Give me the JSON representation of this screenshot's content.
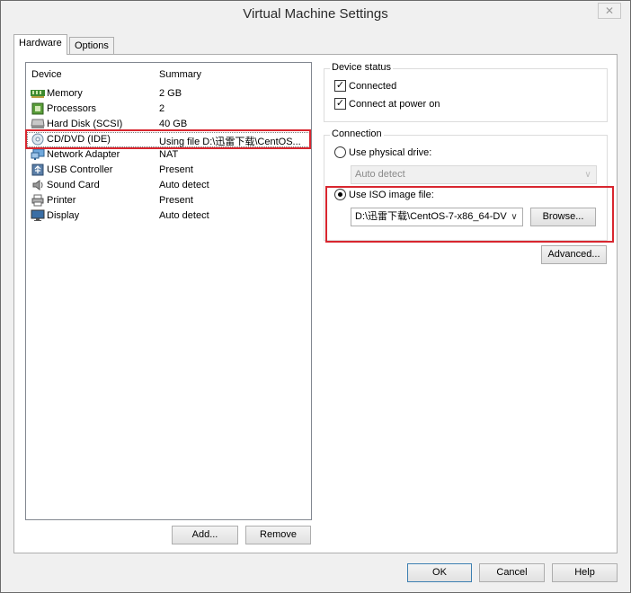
{
  "window": {
    "title": "Virtual Machine Settings",
    "close_glyph": "✕"
  },
  "tabs": [
    {
      "label": "Hardware",
      "active": true
    },
    {
      "label": "Options",
      "active": false
    }
  ],
  "devices": {
    "headers": {
      "device": "Device",
      "summary": "Summary"
    },
    "rows": [
      {
        "name": "Memory",
        "summary": "2 GB",
        "icon": "memory-icon"
      },
      {
        "name": "Processors",
        "summary": "2",
        "icon": "processor-icon"
      },
      {
        "name": "Hard Disk (SCSI)",
        "summary": "40 GB",
        "icon": "hard-disk-icon"
      },
      {
        "name": "CD/DVD (IDE)",
        "summary": "Using file D:\\迅雷下载\\CentOS...",
        "icon": "cd-dvd-icon",
        "selected": true
      },
      {
        "name": "Network Adapter",
        "summary": "NAT",
        "icon": "network-adapter-icon"
      },
      {
        "name": "USB Controller",
        "summary": "Present",
        "icon": "usb-icon"
      },
      {
        "name": "Sound Card",
        "summary": "Auto detect",
        "icon": "sound-card-icon"
      },
      {
        "name": "Printer",
        "summary": "Present",
        "icon": "printer-icon"
      },
      {
        "name": "Display",
        "summary": "Auto detect",
        "icon": "display-icon"
      }
    ],
    "add_label": "Add...",
    "remove_label": "Remove"
  },
  "device_status": {
    "title": "Device status",
    "connected": {
      "label": "Connected",
      "checked": true
    },
    "connect_at_power_on": {
      "label": "Connect at power on",
      "checked": true
    }
  },
  "connection": {
    "title": "Connection",
    "physical": {
      "label": "Use physical drive:",
      "selected": false
    },
    "physical_select": "Auto detect",
    "iso": {
      "label": "Use ISO image file:",
      "selected": true
    },
    "iso_path": "D:\\迅雷下载\\CentOS-7-x86_64-DV",
    "browse_label": "Browse...",
    "advanced_label": "Advanced..."
  },
  "footer": {
    "ok_label": "OK",
    "cancel_label": "Cancel",
    "help_label": "Help"
  },
  "colors": {
    "highlight_box": "#d8262f"
  }
}
